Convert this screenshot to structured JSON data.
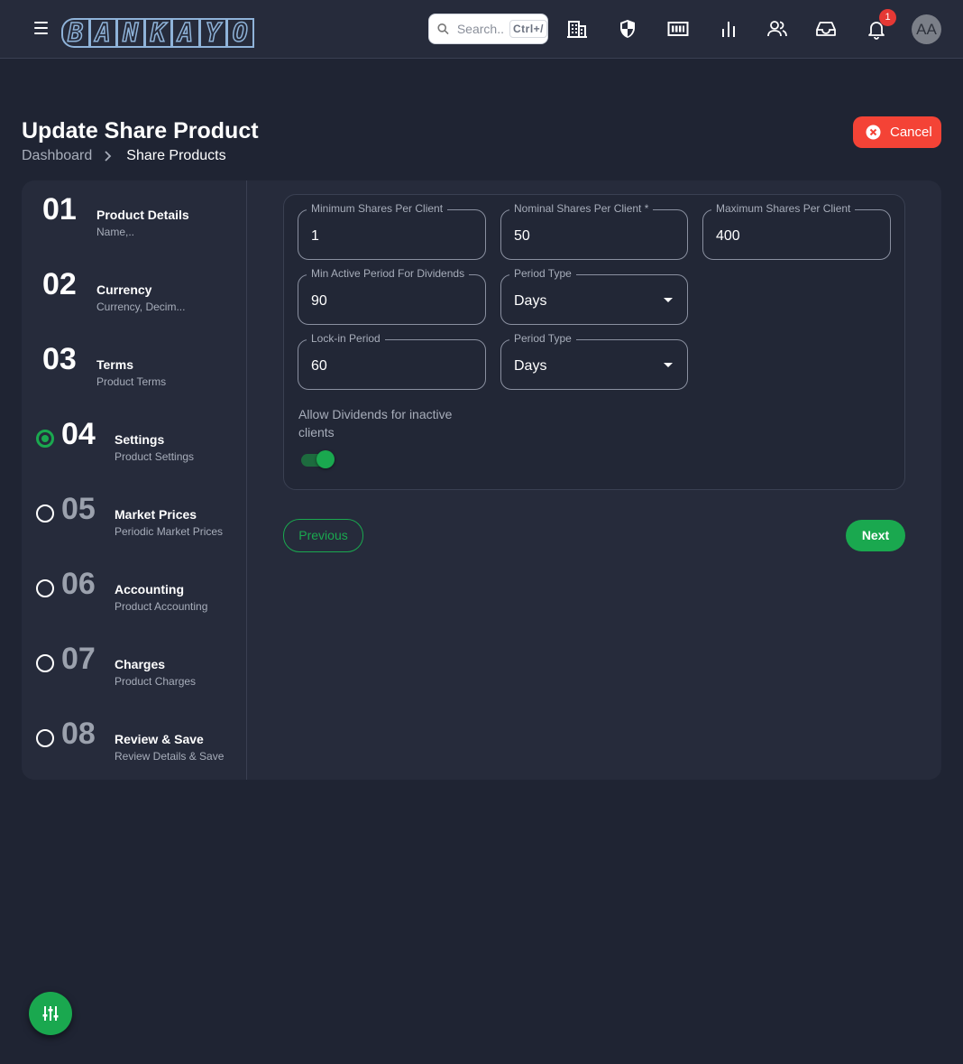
{
  "header": {
    "logo_text": "BANKAYO",
    "logo_letters": [
      "B",
      "A",
      "N",
      "K",
      "A",
      "Y",
      "O"
    ],
    "search": {
      "placeholder": "Search..",
      "shortcut": "Ctrl+/"
    },
    "icons": [
      "menu-icon",
      "building-icon",
      "shield-icon",
      "money-icon",
      "bar-chart-icon",
      "users-icon",
      "inbox-icon",
      "bell-icon"
    ],
    "notification_count": "1",
    "avatar_initials": "AA"
  },
  "page": {
    "title": "Update Share Product",
    "breadcrumb": [
      "Dashboard",
      "Share Products"
    ],
    "cancel_label": "Cancel"
  },
  "steps": [
    {
      "num": "01",
      "title": "Product Details",
      "subtitle": "Name,..",
      "state": "done"
    },
    {
      "num": "02",
      "title": "Currency",
      "subtitle": "Currency, Decim...",
      "state": "done"
    },
    {
      "num": "03",
      "title": "Terms",
      "subtitle": "Product Terms",
      "state": "done"
    },
    {
      "num": "04",
      "title": "Settings",
      "subtitle": "Product Settings",
      "state": "current"
    },
    {
      "num": "05",
      "title": "Market Prices",
      "subtitle": "Periodic Market Prices",
      "state": "pending"
    },
    {
      "num": "06",
      "title": "Accounting",
      "subtitle": "Product Accounting",
      "state": "pending"
    },
    {
      "num": "07",
      "title": "Charges",
      "subtitle": "Product Charges",
      "state": "pending"
    },
    {
      "num": "08",
      "title": "Review & Save",
      "subtitle": "Review Details & Save",
      "state": "pending"
    }
  ],
  "form": {
    "min_shares": {
      "label": "Minimum Shares Per Client",
      "value": "1"
    },
    "nominal_shares": {
      "label": "Nominal Shares Per Client *",
      "value": "50"
    },
    "max_shares": {
      "label": "Maximum Shares Per Client",
      "value": "400"
    },
    "min_active_period": {
      "label": "Min Active Period For Dividends",
      "value": "90"
    },
    "min_active_period_type": {
      "label": "Period Type",
      "value": "Days"
    },
    "lockin_period": {
      "label": "Lock-in Period",
      "value": "60"
    },
    "lockin_period_type": {
      "label": "Period Type",
      "value": "Days"
    },
    "allow_dividends": {
      "label": "Allow Dividends for inactive clients",
      "checked": true
    }
  },
  "buttons": {
    "previous": "Previous",
    "next": "Next"
  },
  "colors": {
    "accent": "#1aa84f",
    "danger": "#f44336",
    "background": "#1f2433",
    "surface": "#262b3b"
  }
}
